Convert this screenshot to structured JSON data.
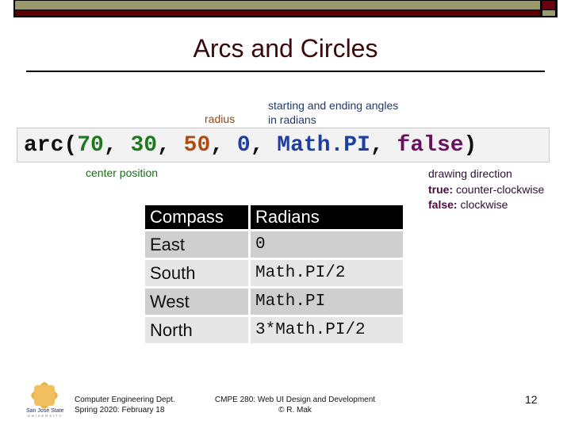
{
  "slide": {
    "title": "Arcs and Circles",
    "annotations": {
      "radius": "radius",
      "angles_line1": "starting and ending angles",
      "angles_line2": "in radians",
      "center": "center position",
      "direction_title": "drawing direction",
      "direction_true_key": "true:",
      "direction_true_value": " counter-clockwise",
      "direction_false_key": "false:",
      "direction_false_value": " clockwise"
    },
    "code": {
      "fn": "arc(",
      "x": "70",
      "sep1": ", ",
      "y": "30",
      "sep2": ", ",
      "radius": "50",
      "sep3": ", ",
      "start": "0",
      "sep4": ", ",
      "end": "Math.PI",
      "sep5": ", ",
      "anticlockwise": "false",
      "close": ")"
    },
    "table": {
      "headers": [
        "Compass",
        "Radians"
      ],
      "rows": [
        [
          "East",
          "0"
        ],
        [
          "South",
          "Math.PI/2"
        ],
        [
          "West",
          "Math.PI"
        ],
        [
          "North",
          "3*Math.PI/2"
        ]
      ]
    },
    "footer": {
      "logo_text": "San José State",
      "logo_sub": "UNIVERSITY",
      "left_line1": "Computer Engineering Dept.",
      "left_line2": "Spring 2020: February 18",
      "center_line1": "CMPE 280: Web UI Design and Development",
      "center_line2": "© R. Mak",
      "page_number": "12"
    },
    "colors": {
      "olive": "#9b9a6c",
      "maroon": "#5c0000",
      "title": "#3a0a0a"
    }
  }
}
